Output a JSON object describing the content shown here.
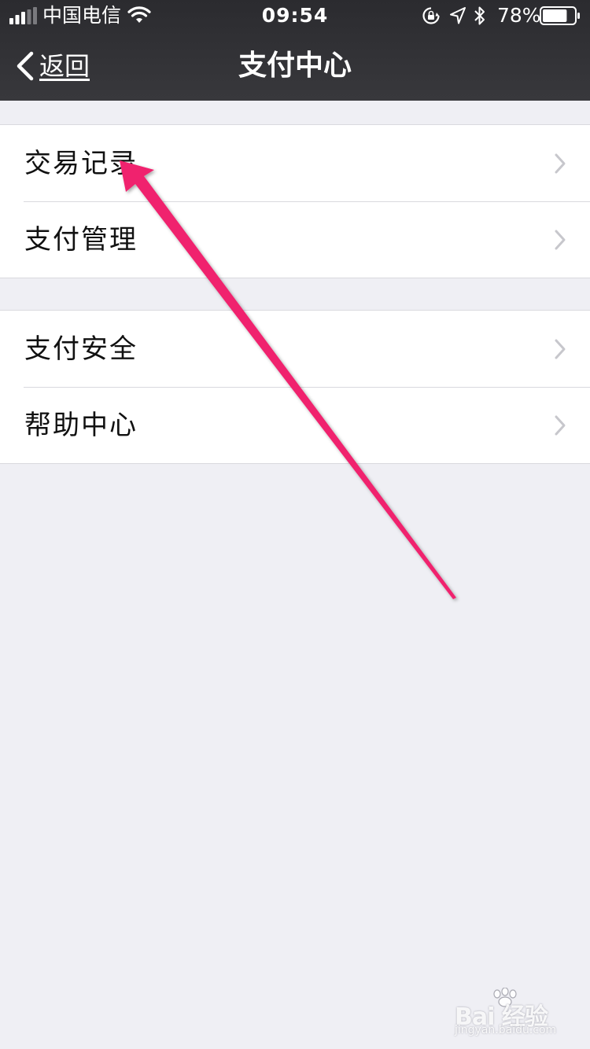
{
  "status_bar": {
    "carrier": "中国电信",
    "time": "09:54",
    "battery_percent": "78%",
    "battery_level": 0.78,
    "signal_bars_filled": 3,
    "signal_bars_total": 5,
    "icons": [
      "signal-icon",
      "wifi-icon",
      "rotation-lock-icon",
      "location-icon",
      "bluetooth-icon",
      "battery-icon"
    ]
  },
  "nav": {
    "back_label": "返回",
    "title": "支付中心"
  },
  "groups": [
    {
      "items": [
        {
          "label": "交易记录"
        },
        {
          "label": "支付管理"
        }
      ]
    },
    {
      "items": [
        {
          "label": "支付安全"
        },
        {
          "label": "帮助中心"
        }
      ]
    }
  ],
  "watermark": {
    "brand": "Bai 经验",
    "url": "jingyan.baidu.com"
  },
  "colors": {
    "header_bg": "#2b2b2f",
    "page_bg": "#efeff4",
    "arrow": "#f0246e",
    "chevron": "#c7c7cc"
  }
}
